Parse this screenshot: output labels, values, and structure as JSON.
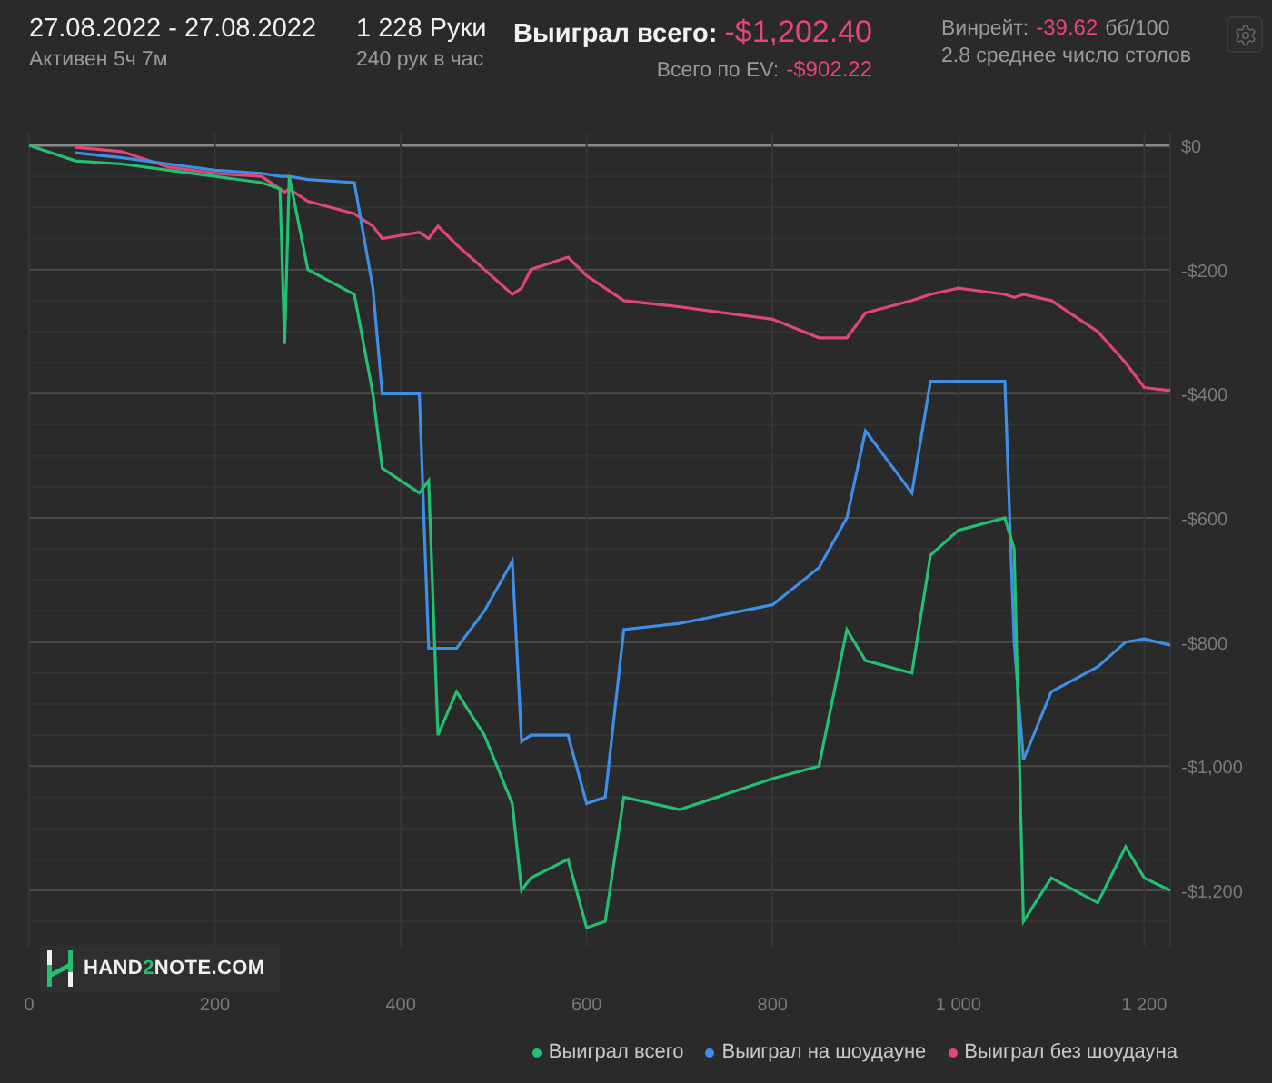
{
  "header": {
    "date_range": "27.08.2022 - 27.08.2022",
    "active": "Активен 5ч 7м",
    "hands": "1 228 Руки",
    "hands_per_hour": "240 рук в час",
    "won_label": "Выиграл всего:",
    "won_value": "-$1,202.40",
    "ev_label": "Всего по EV:",
    "ev_value": "-$902.22",
    "winrate_label": "Винрейт:",
    "winrate_value": "-39.62",
    "winrate_unit": "бб/100",
    "tables": "2.8 среднее число столов"
  },
  "logo": {
    "parts": [
      {
        "text": "HAND",
        "accent": false
      },
      {
        "text": "2",
        "accent": true
      },
      {
        "text": "NOTE.COM",
        "accent": false
      }
    ]
  },
  "chart_data": {
    "type": "line",
    "grid": true,
    "x": [
      0,
      50,
      100,
      150,
      200,
      250,
      270,
      275,
      280,
      300,
      350,
      370,
      380,
      420,
      430,
      440,
      460,
      490,
      520,
      530,
      540,
      580,
      600,
      620,
      640,
      700,
      800,
      850,
      880,
      900,
      950,
      970,
      1000,
      1050,
      1060,
      1070,
      1100,
      1150,
      1180,
      1200,
      1228
    ],
    "series": [
      {
        "name": "Выиграл всего",
        "color": "#22c070",
        "values": [
          0,
          -25,
          -30,
          -40,
          -50,
          -60,
          -70,
          -320,
          -50,
          -200,
          -240,
          -400,
          -520,
          -560,
          -540,
          -950,
          -880,
          -950,
          -1060,
          -1200,
          -1180,
          -1150,
          -1260,
          -1250,
          -1050,
          -1070,
          -1020,
          -1000,
          -780,
          -830,
          -850,
          -660,
          -620,
          -600,
          -650,
          -1250,
          -1180,
          -1220,
          -1130,
          -1180,
          -1200
        ]
      },
      {
        "name": "Выиграл на шоудауне",
        "color": "#3d8fe8",
        "values": [
          null,
          -12,
          -20,
          -30,
          -40,
          -45,
          -50,
          -50,
          -50,
          -55,
          -60,
          -230,
          -400,
          -400,
          -810,
          -810,
          -810,
          -750,
          -670,
          -960,
          -950,
          -950,
          -1060,
          -1050,
          -780,
          -770,
          -740,
          -680,
          -600,
          -460,
          -560,
          -380,
          -380,
          -380,
          -800,
          -990,
          -880,
          -840,
          -800,
          -795,
          -805
        ]
      },
      {
        "name": "Выиграл без шоудауна",
        "color": "#e0457c",
        "values": [
          null,
          -3,
          -10,
          -35,
          -45,
          -50,
          -70,
          -75,
          -70,
          -90,
          -110,
          -130,
          -150,
          -140,
          -150,
          -130,
          -160,
          -200,
          -240,
          -230,
          -200,
          -180,
          -210,
          -230,
          -250,
          -260,
          -280,
          -310,
          -310,
          -270,
          -250,
          -240,
          -230,
          -240,
          -245,
          -240,
          -250,
          -300,
          -350,
          -390,
          -395
        ]
      }
    ],
    "xlim": [
      0,
      1228
    ],
    "ylim": [
      -1290,
      20
    ],
    "xticks": [
      0,
      200,
      400,
      600,
      800,
      {
        "value": 1000,
        "label": "1 000"
      },
      {
        "value": 1200,
        "label": "1 200"
      }
    ],
    "yticks": [
      {
        "value": 0,
        "label": "$0"
      },
      {
        "value": -200,
        "label": "-$200"
      },
      {
        "value": -400,
        "label": "-$400"
      },
      {
        "value": -600,
        "label": "-$600"
      },
      {
        "value": -800,
        "label": "-$800"
      },
      {
        "value": -1000,
        "label": "-$1,000"
      },
      {
        "value": -1200,
        "label": "-$1,200"
      }
    ]
  }
}
